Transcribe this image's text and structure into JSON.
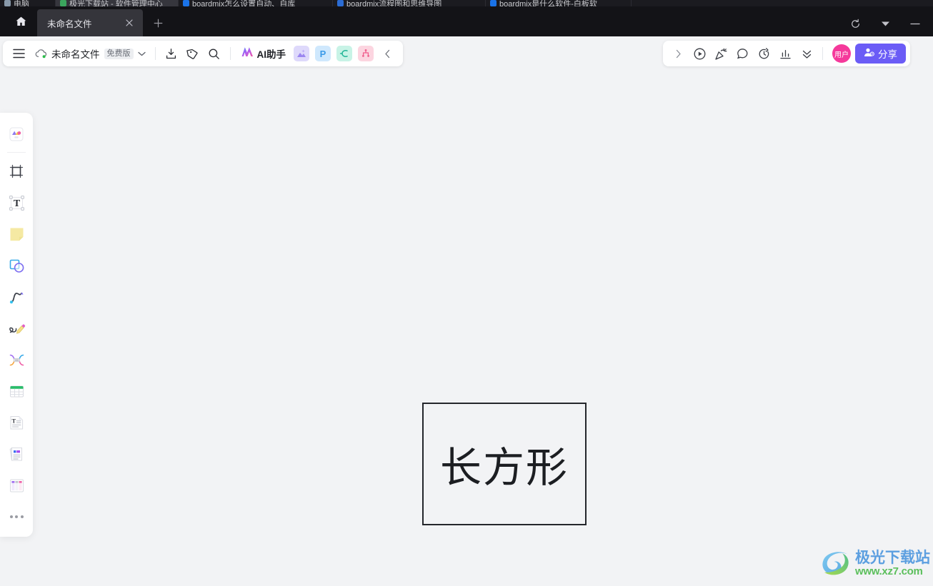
{
  "browser": {
    "ghost_tabs": [
      {
        "label": "电脑",
        "color": "#8899aa"
      },
      {
        "label": "极光下载站 - 软件管理中心",
        "color": "#3ba55d"
      },
      {
        "label": "boardmix怎么设置自动、自库",
        "color": "#1a73e8"
      },
      {
        "label": "boardmix流程图和思维导图",
        "color": "#2b6cd4"
      },
      {
        "label": "boardmix是什么软件-白板软",
        "color": "#1a73e8"
      }
    ],
    "home_icon": "home-icon",
    "tab": {
      "title": "未命名文件",
      "close_icon": "close-icon"
    },
    "new_tab_icon": "plus-icon",
    "window_controls": [
      {
        "name": "refresh-icon"
      },
      {
        "name": "chevron-down-icon"
      },
      {
        "name": "minimize-icon"
      }
    ]
  },
  "toolbar": {
    "menu_icon": "hamburger-menu-icon",
    "cloud_icon": "cloud-sync-icon",
    "file_name": "未命名文件",
    "plan_badge": "免费版",
    "file_dropdown_icon": "chevron-down-icon",
    "import_icon": "import-download-icon",
    "tag_icon": "tag-icon",
    "search_icon": "search-icon",
    "ai_logo_icon": "ai-sparkle-icon",
    "ai_label": "AI助手",
    "app_icons": [
      {
        "name": "image-app-icon",
        "glyph": "",
        "bg": "#ded9fb",
        "fg": "#8b77ee"
      },
      {
        "name": "presentation-app-icon",
        "glyph": "P",
        "bg": "#cfe8fd",
        "fg": "#3b9ae8"
      },
      {
        "name": "mindmap-app-icon",
        "glyph": "",
        "bg": "#c8f3e6",
        "fg": "#25b89a"
      },
      {
        "name": "flowchart-app-icon",
        "glyph": "",
        "bg": "#fcd5e0",
        "fg": "#f0608e"
      }
    ],
    "collapse_icon": "chevron-left-icon"
  },
  "toolbar_right": {
    "expand_icon": "chevron-right-icon",
    "buttons": [
      {
        "name": "present-play-icon"
      },
      {
        "name": "party-popper-icon"
      },
      {
        "name": "comment-bubble-icon"
      },
      {
        "name": "timer-icon"
      },
      {
        "name": "chart-stats-icon"
      },
      {
        "name": "double-chevron-down-icon"
      }
    ],
    "avatar_label": "用户",
    "share_icon": "share-person-icon",
    "share_label": "分享"
  },
  "sidebar": {
    "items": [
      {
        "name": "sidebar-item-templates",
        "icon": "templates-icon"
      },
      {
        "name": "sidebar-item-frame",
        "icon": "frame-icon"
      },
      {
        "name": "sidebar-item-text",
        "icon": "text-tool-icon"
      },
      {
        "name": "sidebar-item-sticky-note",
        "icon": "sticky-note-icon"
      },
      {
        "name": "sidebar-item-shapes",
        "icon": "shapes-icon"
      },
      {
        "name": "sidebar-item-connector",
        "icon": "connector-curve-icon"
      },
      {
        "name": "sidebar-item-pen",
        "icon": "pen-draw-icon"
      },
      {
        "name": "sidebar-item-mindmap",
        "icon": "mindmap-icon"
      },
      {
        "name": "sidebar-item-table",
        "icon": "table-icon"
      },
      {
        "name": "sidebar-item-document",
        "icon": "document-icon"
      },
      {
        "name": "sidebar-item-card",
        "icon": "card-note-icon"
      },
      {
        "name": "sidebar-item-kanban",
        "icon": "kanban-board-icon"
      },
      {
        "name": "sidebar-item-more",
        "icon": "more-dots-icon"
      }
    ]
  },
  "canvas": {
    "shape": {
      "label": "长方形",
      "border_color": "#24262b"
    },
    "background_color": "#f2f3f5"
  },
  "watermark": {
    "title": "极光下载站",
    "url": "www.xz7.com"
  }
}
